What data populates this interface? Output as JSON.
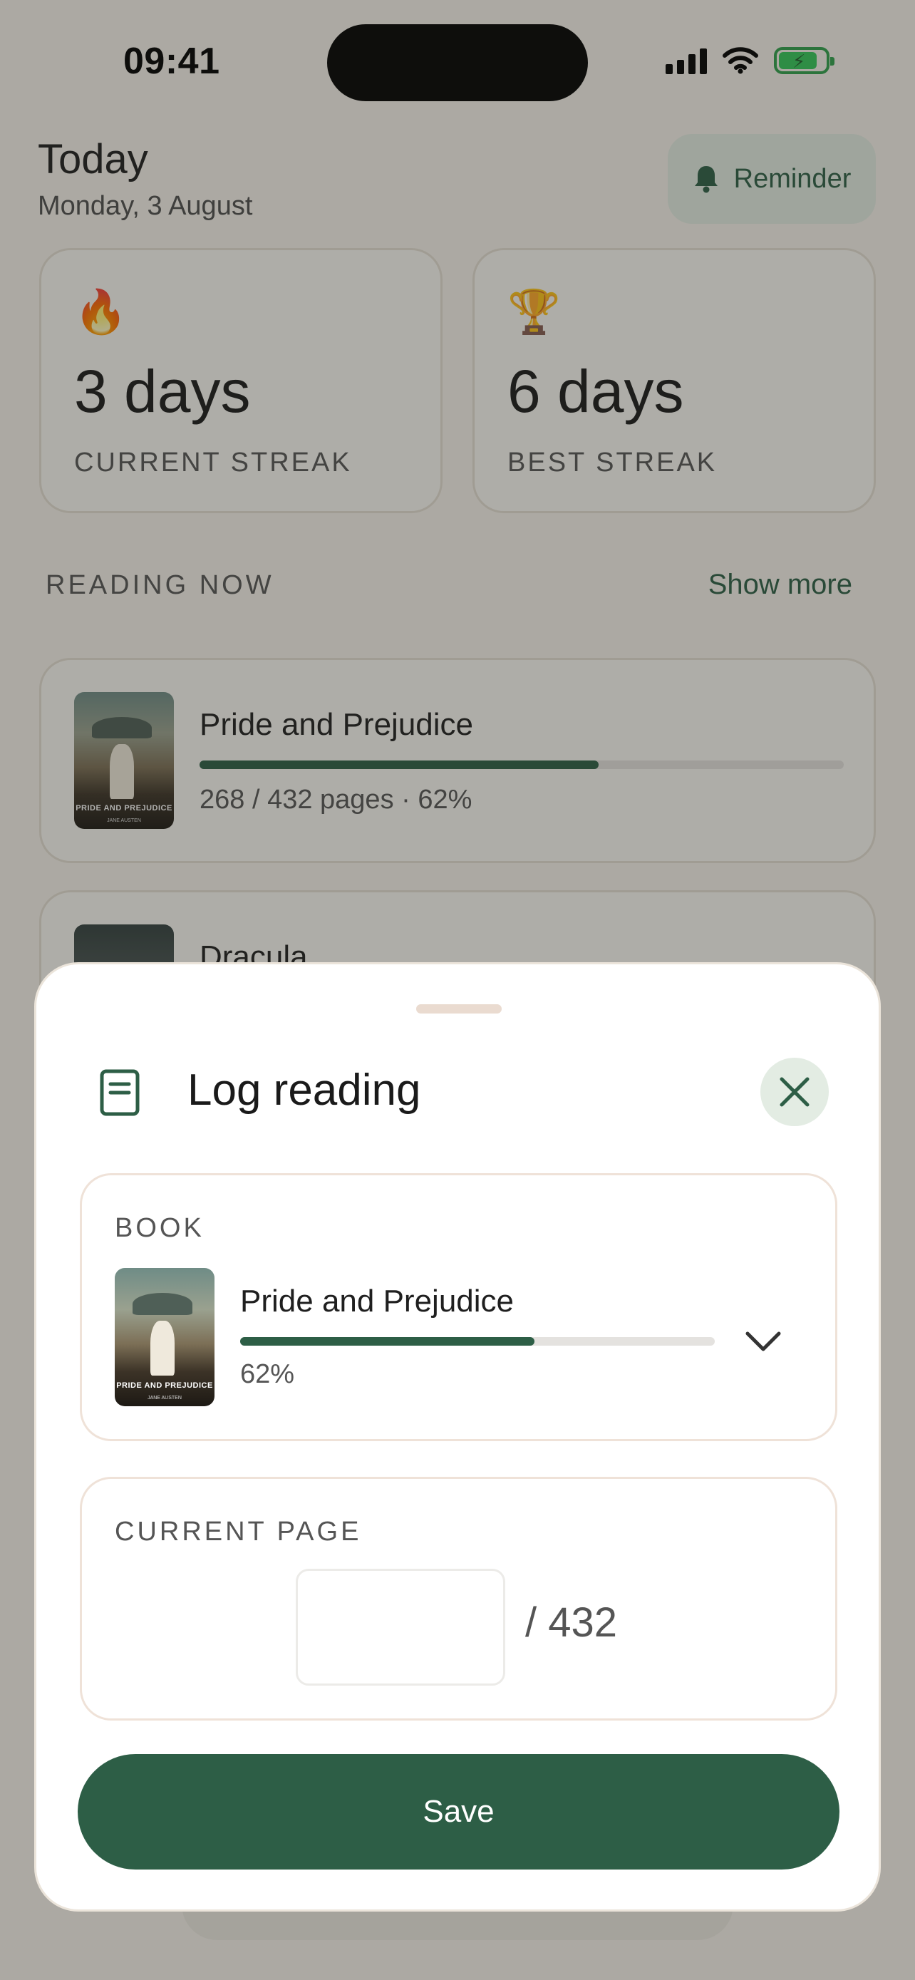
{
  "status_bar": {
    "time": "09:41",
    "signal_icon": "cellular-signal-icon",
    "wifi_icon": "wifi-icon",
    "battery_icon": "battery-charging-icon"
  },
  "header": {
    "title": "Today",
    "date": "Monday, 3 August",
    "reminder_label": "Reminder",
    "reminder_icon": "bell-icon"
  },
  "stats": [
    {
      "emoji": "🔥",
      "value": "3 days",
      "label": "CURRENT STREAK"
    },
    {
      "emoji": "🏆",
      "value": "6 days",
      "label": "BEST STREAK"
    }
  ],
  "reading_now": {
    "title": "READING NOW",
    "show_more": "Show more",
    "books": [
      {
        "title": "Pride and Prejudice",
        "progress": 0.62,
        "meta": "268 / 432 pages · 62%",
        "cover_title": "PRIDE AND PREJUDICE",
        "cover_author": "JANE AUSTEN"
      },
      {
        "title": "Dracula"
      }
    ]
  },
  "sheet": {
    "title": "Log reading",
    "book_icon": "book-icon",
    "close_icon": "close-icon",
    "book_field": {
      "label": "BOOK",
      "title": "Pride and Prejudice",
      "progress": 0.62,
      "percent": "62%",
      "cover_title": "PRIDE AND PREJUDICE",
      "cover_author": "JANE AUSTEN",
      "chevron_icon": "chevron-down-icon"
    },
    "page_field": {
      "label": "CURRENT PAGE",
      "value": "",
      "total": "/ 432"
    },
    "save_label": "Save"
  },
  "colors": {
    "accent": "#2d5e46",
    "accent_soft": "#e3ece3",
    "background": "#f7f3ec",
    "track": "#e4e2df"
  }
}
